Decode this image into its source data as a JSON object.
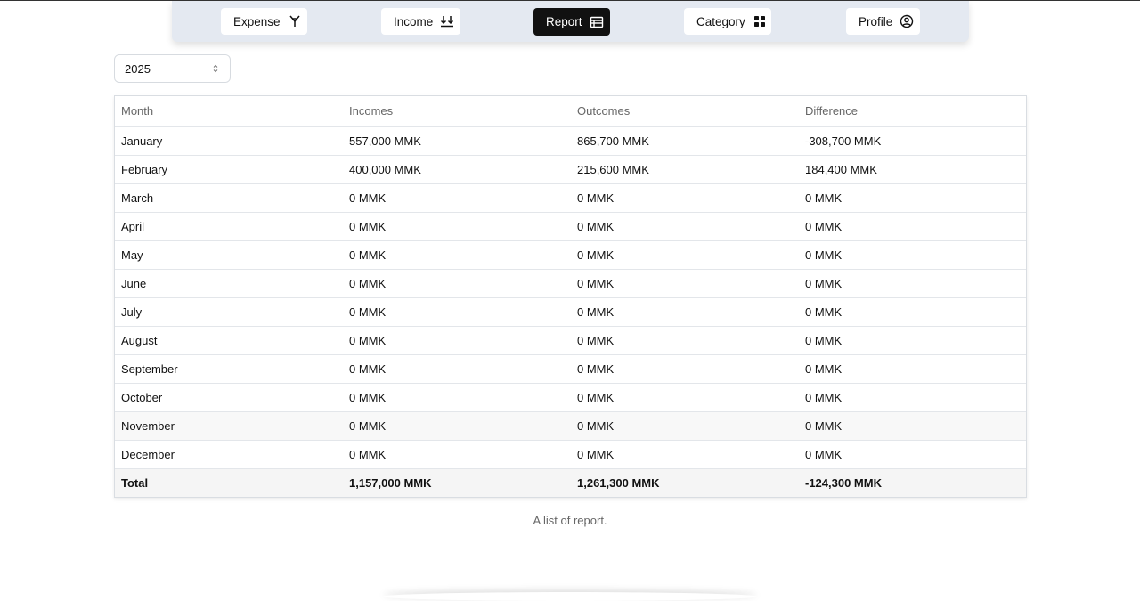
{
  "nav": {
    "items": [
      {
        "label": "Expense",
        "icon": "expense-icon",
        "active": false
      },
      {
        "label": "Income",
        "icon": "income-download-icon",
        "active": false
      },
      {
        "label": "Report",
        "icon": "report-table-icon",
        "active": true
      },
      {
        "label": "Category",
        "icon": "category-grid-icon",
        "active": false
      },
      {
        "label": "Profile",
        "icon": "profile-user-icon",
        "active": false
      }
    ]
  },
  "filter": {
    "year": "2025"
  },
  "table": {
    "headers": [
      "Month",
      "Incomes",
      "Outcomes",
      "Difference"
    ],
    "rows": [
      [
        "January",
        "557,000 MMK",
        "865,700 MMK",
        "-308,700 MMK"
      ],
      [
        "February",
        "400,000 MMK",
        "215,600 MMK",
        "184,400 MMK"
      ],
      [
        "March",
        "0 MMK",
        "0 MMK",
        "0 MMK"
      ],
      [
        "April",
        "0 MMK",
        "0 MMK",
        "0 MMK"
      ],
      [
        "May",
        "0 MMK",
        "0 MMK",
        "0 MMK"
      ],
      [
        "June",
        "0 MMK",
        "0 MMK",
        "0 MMK"
      ],
      [
        "July",
        "0 MMK",
        "0 MMK",
        "0 MMK"
      ],
      [
        "August",
        "0 MMK",
        "0 MMK",
        "0 MMK"
      ],
      [
        "September",
        "0 MMK",
        "0 MMK",
        "0 MMK"
      ],
      [
        "October",
        "0 MMK",
        "0 MMK",
        "0 MMK"
      ],
      [
        "November",
        "0 MMK",
        "0 MMK",
        "0 MMK"
      ],
      [
        "December",
        "0 MMK",
        "0 MMK",
        "0 MMK"
      ]
    ],
    "total": [
      "Total",
      "1,157,000 MMK",
      "1,261,300 MMK",
      "-124,300 MMK"
    ],
    "caption": "A list of report."
  },
  "colors": {
    "nav_bg": "#e4e9f1",
    "active_bg": "#111111",
    "border": "#d9dde2"
  }
}
